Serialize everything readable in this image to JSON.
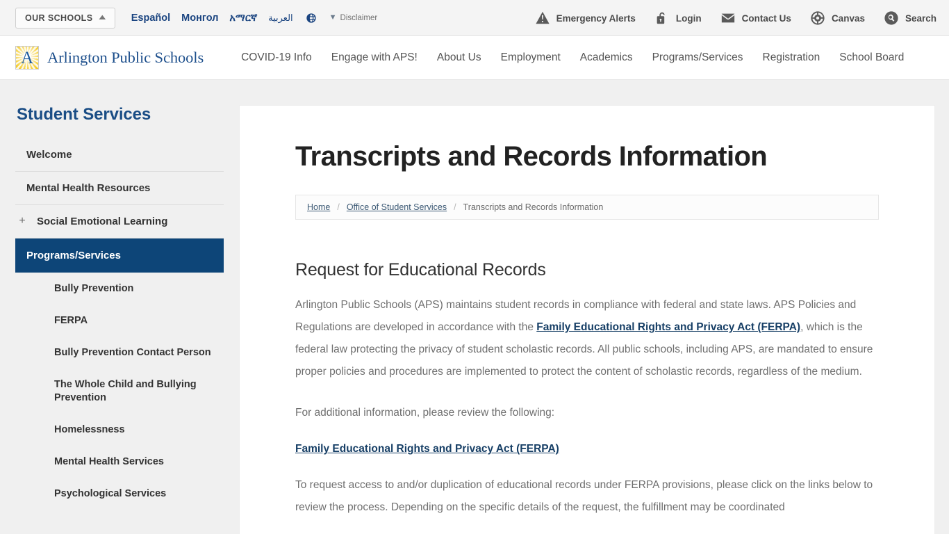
{
  "utility_bar": {
    "our_schools_label": "OUR SCHOOLS",
    "our_schools_icon": "double-chevron-up-icon",
    "languages": [
      {
        "label": "Español",
        "name": "lang-spanish"
      },
      {
        "label": "Монгол",
        "name": "lang-mongolian"
      },
      {
        "label": "አማርኛ",
        "name": "lang-amharic"
      },
      {
        "label": "العربية",
        "name": "lang-arabic"
      }
    ],
    "globe_icon": "globe-icon",
    "disclaimer_chevron": "chevron-down-icon",
    "disclaimer_label": "Disclaimer",
    "right_items": [
      {
        "label": "Emergency Alerts",
        "icon": "alert-triangle-icon",
        "name": "emergency-alerts"
      },
      {
        "label": "Login",
        "icon": "lock-icon",
        "name": "login"
      },
      {
        "label": "Contact Us",
        "icon": "envelope-icon",
        "name": "contact-us"
      },
      {
        "label": "Canvas",
        "icon": "canvas-icon",
        "name": "canvas"
      },
      {
        "label": "Search",
        "icon": "search-icon",
        "name": "search"
      }
    ]
  },
  "masthead": {
    "logo_letter": "A",
    "brand_name": "Arlington Public Schools",
    "nav": [
      {
        "label": "COVID-19 Info",
        "name": "nav-covid-19-info"
      },
      {
        "label": "Engage with APS!",
        "name": "nav-engage-with-aps"
      },
      {
        "label": "About Us",
        "name": "nav-about-us"
      },
      {
        "label": "Employment",
        "name": "nav-employment"
      },
      {
        "label": "Academics",
        "name": "nav-academics"
      },
      {
        "label": "Programs/Services",
        "name": "nav-programs-services"
      },
      {
        "label": "Registration",
        "name": "nav-registration"
      },
      {
        "label": "School Board",
        "name": "nav-school-board"
      }
    ]
  },
  "sidebar": {
    "title": "Student Services",
    "items": [
      {
        "label": "Welcome",
        "type": "item",
        "active": false
      },
      {
        "label": "Mental Health Resources",
        "type": "item",
        "active": false
      },
      {
        "label": "Social Emotional Learning",
        "type": "expandable",
        "active": false,
        "expand_icon": "plus-icon"
      },
      {
        "label": "Programs/Services",
        "type": "item",
        "active": true
      }
    ],
    "sub_items": [
      {
        "label": "Bully Prevention"
      },
      {
        "label": "FERPA"
      },
      {
        "label": "Bully Prevention Contact Person"
      },
      {
        "label": "The Whole Child and Bullying Prevention"
      },
      {
        "label": "Homelessness"
      },
      {
        "label": "Mental Health Services"
      },
      {
        "label": "Psychological Services"
      }
    ]
  },
  "content": {
    "page_title": "Transcripts and Records Information",
    "breadcrumb": {
      "home": "Home",
      "parent": "Office of Student Services",
      "current": "Transcripts and Records Information",
      "separator": "/"
    },
    "section_heading": "Request for Educational Records",
    "paragraph_1_part_1": "Arlington Public Schools (APS) maintains student records in compliance with federal and state laws. APS Policies and Regulations are developed in accordance with the ",
    "paragraph_1_link": "Family Educational Rights and Privacy Act (FERPA)",
    "paragraph_1_part_2": ", which is the federal law protecting the privacy of student scholastic records. All public schools, including APS, are mandated to ensure proper policies and procedures are implemented to protect the content of scholastic records, regardless of the medium.",
    "paragraph_2": "For additional information, please review the following:",
    "ferpa_link": "Family Educational Rights and Privacy Act (FERPA)",
    "paragraph_3": "To request access to and/or duplication of educational records under FERPA provisions, please click on the links below to review the process. Depending on the specific details of the request, the fulfillment may be coordinated"
  },
  "colors": {
    "brand_blue": "#1d4f8c",
    "active_nav_blue": "#0d4578",
    "link_blue": "#173f66",
    "logo_gold": "#f6d44b",
    "page_bg": "#f0f0f0"
  }
}
